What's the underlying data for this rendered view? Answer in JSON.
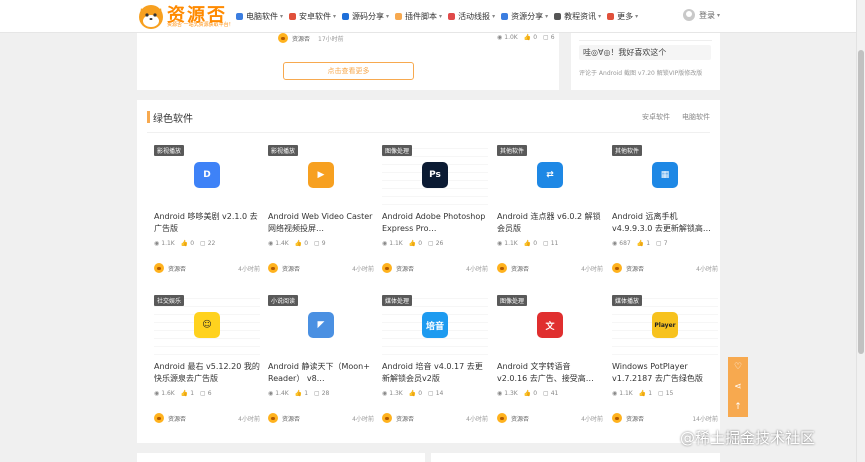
{
  "header": {
    "logo_title": "资源否",
    "logo_sub": "资源否 一站式资源获取平台！",
    "nav": [
      {
        "label": "电脑软件",
        "icon": "monitor-icon",
        "color": "#3b7de0"
      },
      {
        "label": "安卓软件",
        "icon": "android-icon",
        "color": "#e0503b"
      },
      {
        "label": "源码分享",
        "icon": "code-icon",
        "color": "#1e6fd9"
      },
      {
        "label": "插件脚本",
        "icon": "plugin-icon",
        "color": "#f7a94f"
      },
      {
        "label": "活动线报",
        "icon": "gift-icon",
        "color": "#e04a4a"
      },
      {
        "label": "资源分享",
        "icon": "send-icon",
        "color": "#3b7de0"
      },
      {
        "label": "教程资讯",
        "icon": "book-icon",
        "color": "#555555"
      },
      {
        "label": "更多",
        "icon": "more-icon",
        "color": "#e0503b"
      }
    ],
    "user_label": "登录"
  },
  "top_card": {
    "author": "资源否",
    "time": "17小时前",
    "views": "1.0K",
    "likes": "0",
    "comments": "6",
    "load_more": "点击查看更多"
  },
  "comment_widget": {
    "comment": "哇◎∀◎！我好喜欢这个",
    "meta": "评论于 Android 截图 v7.20 解锁VIP版修改版"
  },
  "section": {
    "title": "绿色软件",
    "links": [
      "安卓软件",
      "电脑软件"
    ],
    "cards": [
      {
        "tag": "影视播放",
        "icon_text": "D",
        "icon_color": "#3e82f7",
        "title": "Android 哆哆美剧 v2.1.0 去广告版",
        "views": "1.1K",
        "likes": "0",
        "comments": "22",
        "author": "资源否",
        "time": "4小时前",
        "wm": false
      },
      {
        "tag": "影视播放",
        "icon_text": "▶",
        "icon_color": "#f7a020",
        "title": "Android Web Video Caster 网络视频投屏…",
        "views": "1.4K",
        "likes": "0",
        "comments": "9",
        "author": "资源否",
        "time": "4小时前",
        "wm": false
      },
      {
        "tag": "图像处理",
        "icon_text": "Ps",
        "icon_color": "#0b1b33",
        "title": "Android Adobe Photoshop Express Pro…",
        "views": "1.1K",
        "likes": "0",
        "comments": "26",
        "author": "资源否",
        "time": "4小时前",
        "wm": true
      },
      {
        "tag": "其他软件",
        "icon_text": "⇄",
        "icon_color": "#1e88e5",
        "title": "Android 连点器 v6.0.2 解锁会员版",
        "views": "1.1K",
        "likes": "0",
        "comments": "11",
        "author": "资源否",
        "time": "4小时前",
        "wm": false
      },
      {
        "tag": "其他软件",
        "icon_text": "▦",
        "icon_color": "#1e88e5",
        "title": "Android 远离手机 v4.9.9.3.0 去更新解锁高…",
        "views": "687",
        "likes": "1",
        "comments": "7",
        "author": "资源否",
        "time": "4小时前",
        "wm": false
      },
      {
        "tag": "社交娱乐",
        "icon_text": "☺",
        "icon_color": "#ffd21e",
        "title": "Android 最右 v5.12.20 我的快乐源泉去广告版",
        "views": "1.6K",
        "likes": "1",
        "comments": "6",
        "author": "资源否",
        "time": "4小时前",
        "wm": true
      },
      {
        "tag": "小说阅读",
        "icon_text": "◤",
        "icon_color": "#4a90e2",
        "title": "Android 静读天下（Moon+ Reader） v8…",
        "views": "1.4K",
        "likes": "1",
        "comments": "28",
        "author": "资源否",
        "time": "4小时前",
        "wm": false
      },
      {
        "tag": "媒体处理",
        "icon_text": "培音",
        "icon_color": "#1e9bf0",
        "title": "Android 培音 v4.0.17 去更新解锁会员v2版",
        "views": "1.3K",
        "likes": "0",
        "comments": "14",
        "author": "资源否",
        "time": "4小时前",
        "wm": true
      },
      {
        "tag": "图像处理",
        "icon_text": "文",
        "icon_color": "#e02f2f",
        "title": "Android 文字转语音 v2.0.16 去广告、接受高…",
        "views": "1.3K",
        "likes": "0",
        "comments": "41",
        "author": "资源否",
        "time": "4小时前",
        "wm": false
      },
      {
        "tag": "媒体播放",
        "icon_text": "Player",
        "icon_color": "#f7c21e",
        "title": "Windows PotPlayer v1.7.2187 去广告绿色版",
        "views": "1.1K",
        "likes": "1",
        "comments": "15",
        "author": "资源否",
        "time": "14小时前",
        "wm": true
      }
    ]
  },
  "float_bar": {
    "icons": [
      "heart-icon",
      "share-icon",
      "arrow-up-icon"
    ]
  },
  "watermark": "@稀土掘金技术社区"
}
